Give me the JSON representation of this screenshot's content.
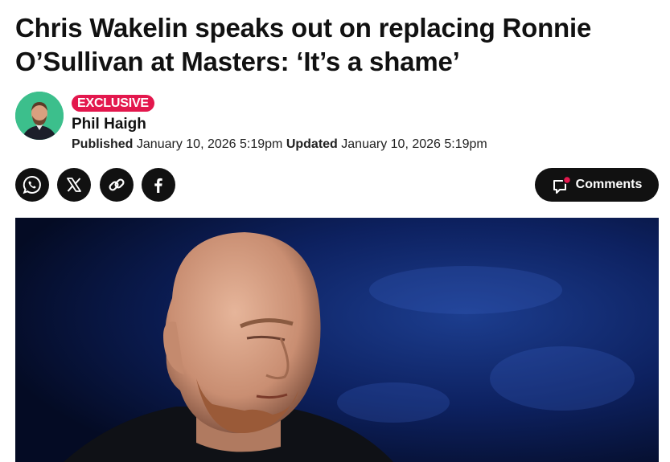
{
  "article": {
    "headline": "Chris Wakelin speaks out on replacing Ronnie O’Sullivan at Masters: ‘It’s a shame’",
    "badge": "EXCLUSIVE",
    "author": "Phil Haigh",
    "published_label": "Published",
    "published_date": "January 10, 2026 5:19pm",
    "updated_label": "Updated",
    "updated_date": "January 10, 2026 5:19pm"
  },
  "share": {
    "icons": [
      "whatsapp-icon",
      "x-icon",
      "link-icon",
      "facebook-icon"
    ]
  },
  "comments": {
    "label": "Comments"
  },
  "colors": {
    "badge": "#e3174d",
    "button_bg": "#111111",
    "avatar_bg": "#3cbf8c",
    "comment_dot": "#e3174d",
    "hero_bg": "#0b1a4a"
  }
}
